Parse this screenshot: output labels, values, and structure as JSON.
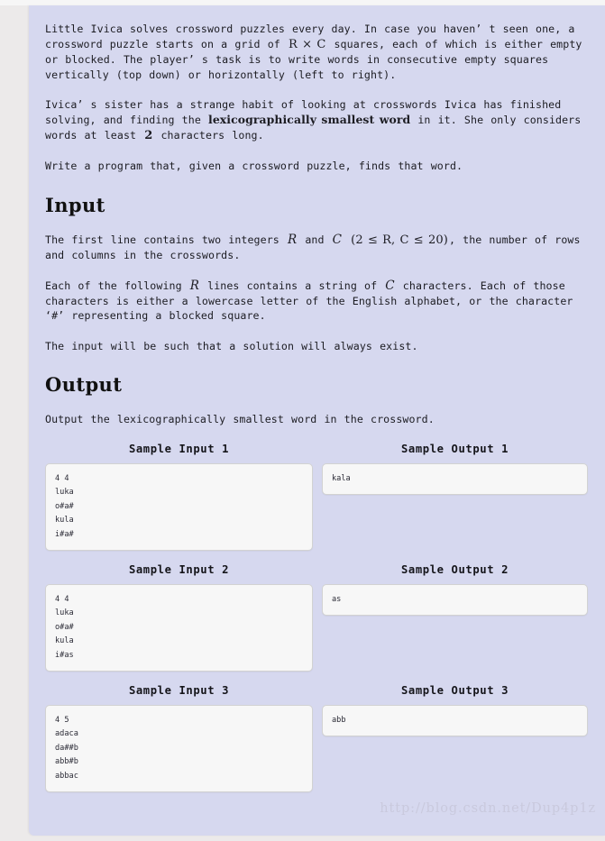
{
  "document": {
    "paragraphs": [
      {
        "id": "intro",
        "segments": [
          {
            "type": "text",
            "value": "Little Ivica solves crossword puzzles every day. In case you haven’ t seen one, a crossword puzzle starts on a grid of "
          },
          {
            "type": "math",
            "value": "R × C"
          },
          {
            "type": "text",
            "value": " squares, each of which is either empty or blocked. The player’ s task is to write words in consecutive empty squares vertically (top down) or horizontally (left to right)."
          }
        ]
      },
      {
        "id": "sister",
        "segments": [
          {
            "type": "text",
            "value": "Ivica’ s sister has a strange habit of looking at crosswords Ivica has finished solving, and finding the "
          },
          {
            "type": "bold",
            "value": "lexicographically smallest word"
          },
          {
            "type": "text",
            "value": " in it. She only considers words at least "
          },
          {
            "type": "mathnum",
            "value": "2"
          },
          {
            "type": "text",
            "value": " characters long."
          }
        ]
      },
      {
        "id": "task",
        "segments": [
          {
            "type": "text",
            "value": "Write a program that, given a crossword puzzle, finds that word."
          }
        ]
      }
    ],
    "sections": [
      {
        "id": "input",
        "heading": "Input",
        "paragraphs": [
          {
            "id": "input-first-line",
            "segments": [
              {
                "type": "text",
                "value": "The first line contains two integers "
              },
              {
                "type": "math",
                "value": "R"
              },
              {
                "type": "text",
                "value": " and "
              },
              {
                "type": "math",
                "value": "C"
              },
              {
                "type": "text",
                "value": " "
              },
              {
                "type": "mathexpr",
                "value": "(2 ≤ R, C ≤ 20)"
              },
              {
                "type": "text",
                "value": ", the number of rows and columns in the crosswords."
              }
            ]
          },
          {
            "id": "input-rows",
            "segments": [
              {
                "type": "text",
                "value": "Each of the following "
              },
              {
                "type": "math",
                "value": "R"
              },
              {
                "type": "text",
                "value": " lines contains a string of "
              },
              {
                "type": "math",
                "value": "C"
              },
              {
                "type": "text",
                "value": " characters. Each of those characters is either a lowercase letter of the English alphabet, or the character ‘#’ representing a blocked square."
              }
            ]
          },
          {
            "id": "input-guarantee",
            "segments": [
              {
                "type": "text",
                "value": "The input will be such that a solution will always exist."
              }
            ]
          }
        ]
      },
      {
        "id": "output",
        "heading": "Output",
        "paragraphs": [
          {
            "id": "output-desc",
            "segments": [
              {
                "type": "text",
                "value": "Output the lexicographically smallest word in the crossword."
              }
            ]
          }
        ]
      }
    ]
  },
  "samples": [
    {
      "input_title": "Sample Input 1",
      "output_title": "Sample Output 1",
      "input": "4 4\nluka\no#a#\nkula\ni#a#",
      "output": "kala"
    },
    {
      "input_title": "Sample Input 2",
      "output_title": "Sample Output 2",
      "input": "4 4\nluka\no#a#\nkula\ni#as",
      "output": "as"
    },
    {
      "input_title": "Sample Input 3",
      "output_title": "Sample Output 3",
      "input": "4 5\nadaca\nda##b\nabb#b\nabbac",
      "output": "abb"
    }
  ],
  "watermark": {
    "text": "http://blog.csdn.net/Dup4p1z"
  },
  "colors": {
    "panel_background": "#d6d8ef",
    "gutter_background": "#eceaea",
    "sample_box_background": "#f7f7f7",
    "sample_box_border": "#d2d2d2",
    "text": "#1c1c22",
    "watermark": "#c9c9dd"
  }
}
